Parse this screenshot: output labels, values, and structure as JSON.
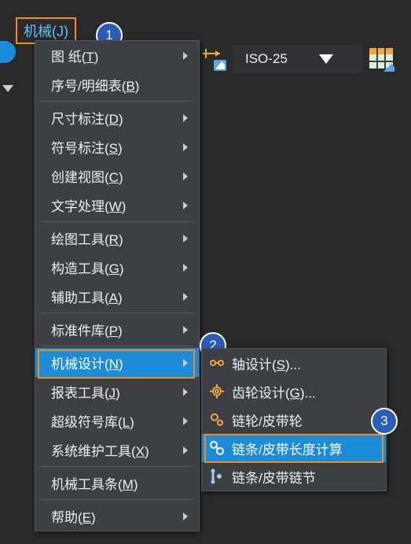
{
  "menubar": {
    "mechanical_label": "机械(J)"
  },
  "toolbar": {
    "iso_label": "ISO-25"
  },
  "menu": {
    "items": [
      {
        "pre": "图",
        "sp": "    ",
        "post": "纸(",
        "u": "T",
        "tail": ")",
        "arrow": true
      },
      {
        "pre": "序号/明细表(",
        "u": "B",
        "tail": ")",
        "arrow": false
      },
      {
        "pre": "尺寸标注(",
        "u": "D",
        "tail": ")",
        "arrow": true
      },
      {
        "pre": "符号标注(",
        "u": "S",
        "tail": ")",
        "arrow": true
      },
      {
        "pre": "创建视图(",
        "u": "C",
        "tail": ")",
        "arrow": true
      },
      {
        "pre": "文字处理(",
        "u": "W",
        "tail": ")",
        "arrow": true
      },
      {
        "pre": "绘图工具(",
        "u": "R",
        "tail": ")",
        "arrow": true
      },
      {
        "pre": "构造工具(",
        "u": "G",
        "tail": ")",
        "arrow": true
      },
      {
        "pre": "辅助工具(",
        "u": "A",
        "tail": ")",
        "arrow": true
      },
      {
        "pre": "标准件库(",
        "u": "P",
        "tail": ")",
        "arrow": true
      },
      {
        "pre": "机械设计(",
        "u": "N",
        "tail": ")",
        "arrow": true,
        "sel": true
      },
      {
        "pre": "报表工具(",
        "u": "J",
        "tail": ")",
        "arrow": true
      },
      {
        "pre": "超级符号库(",
        "u": "L",
        "tail": ")",
        "arrow": true
      },
      {
        "pre": "系统维护工具(",
        "u": "X",
        "tail": ")",
        "arrow": true
      },
      {
        "pre": "机械工具条(",
        "u": "M",
        "tail": ")",
        "arrow": false
      },
      {
        "pre": "帮助(",
        "u": "E",
        "tail": ")",
        "arrow": true
      }
    ],
    "separators_after": [
      1,
      5,
      8,
      9,
      13,
      14
    ]
  },
  "submenu": {
    "items": [
      {
        "pre": "轴设计(",
        "u": "S",
        "tail": ")...",
        "arrow": false,
        "icon": "shaft"
      },
      {
        "pre": "齿轮设计(",
        "u": "G",
        "tail": ")...",
        "arrow": false,
        "icon": "gear"
      },
      {
        "pre": "链轮/皮带轮",
        "arrow": true,
        "icon": "sprocket"
      },
      {
        "pre": "链条/皮带长度计算",
        "arrow": false,
        "icon": "chain",
        "sel": true
      },
      {
        "pre": "链条/皮带链节",
        "arrow": false,
        "icon": "link"
      }
    ]
  },
  "badges": {
    "b1": "1",
    "b2": "2",
    "b3": "3"
  }
}
